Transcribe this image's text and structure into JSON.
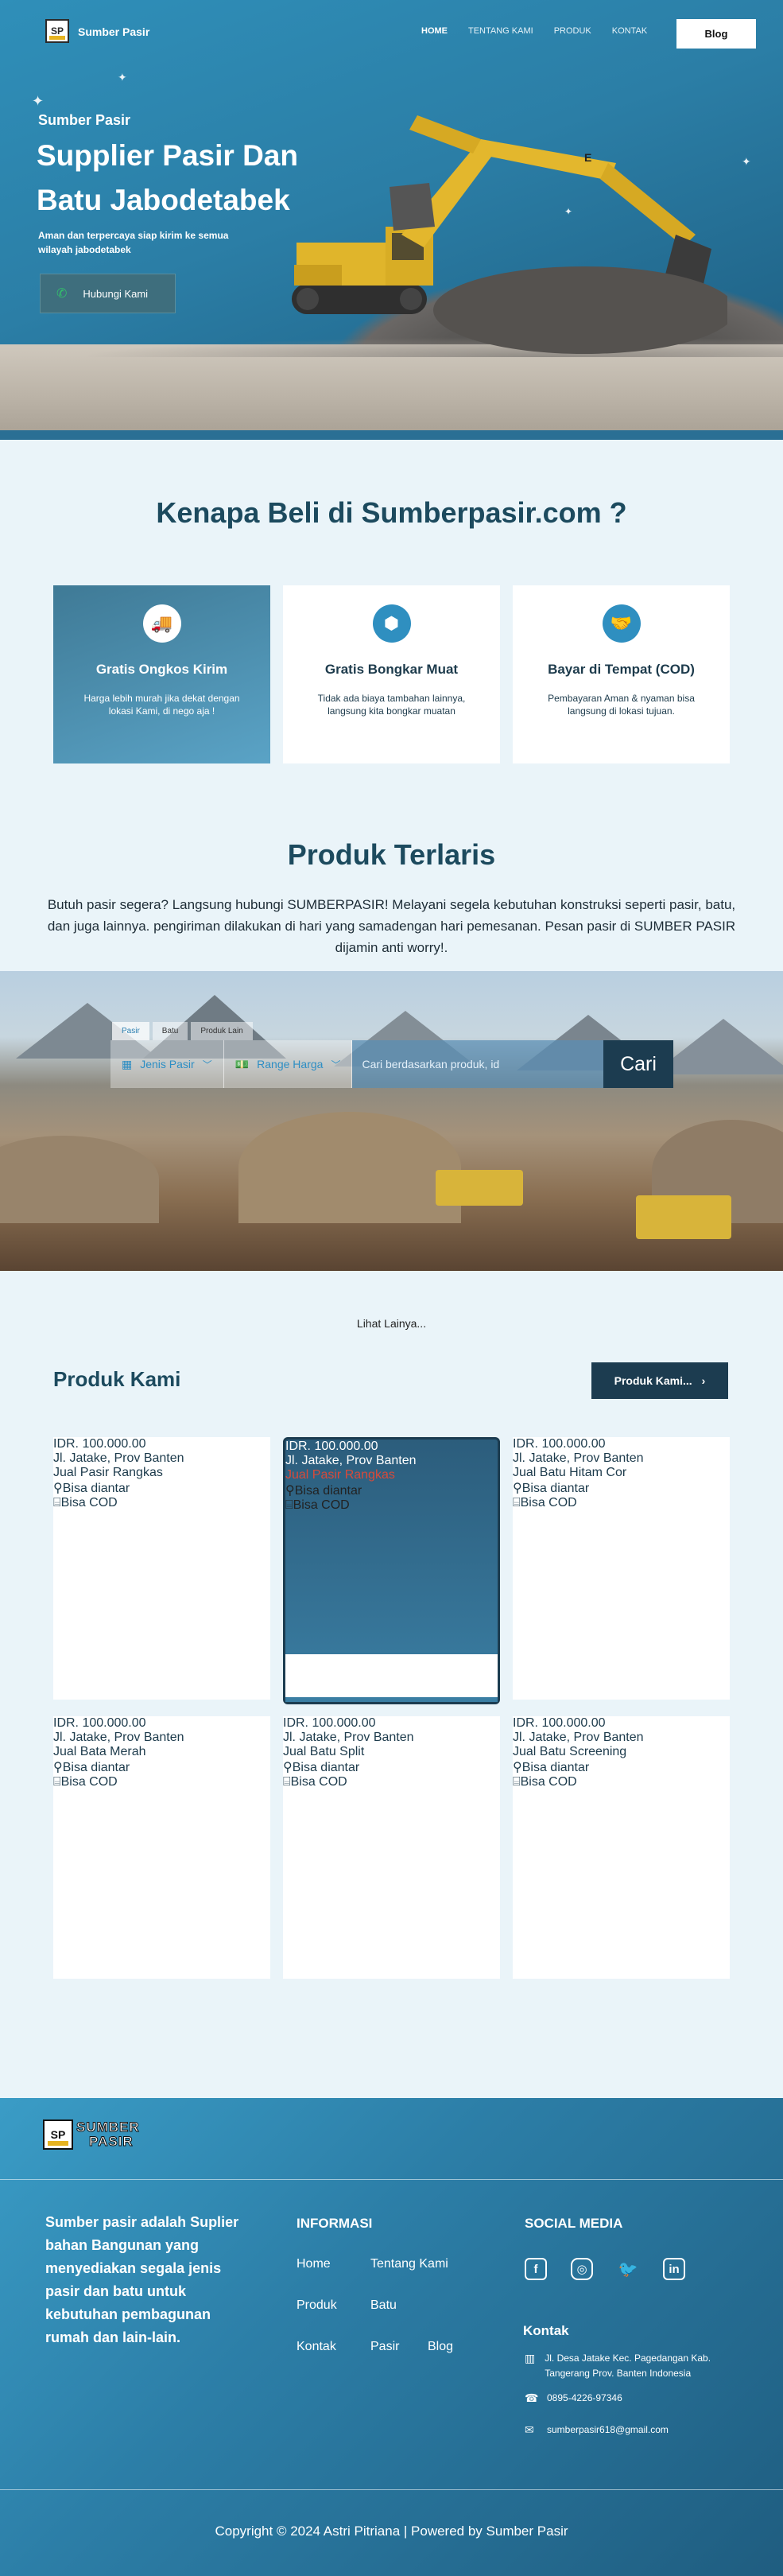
{
  "nav": {
    "logo_text": "SP",
    "brand": "Sumber Pasir",
    "links": [
      "HOME",
      "TENTANG KAMI",
      "PRODUK",
      "KONTAK"
    ],
    "blog_label": "Blog"
  },
  "hero": {
    "eyebrow": "Sumber Pasir",
    "title": "Supplier Pasir Dan Batu Jabodetabek",
    "subtitle": "Aman dan terpercaya siap kirim ke semua wilayah jabodetabek",
    "cta_label": "Hubungi Kami",
    "machine_badge": "E"
  },
  "why": {
    "title": "Kenapa Beli di Sumberpasir.com ?",
    "cards": [
      {
        "title": "Gratis Ongkos Kirim",
        "text": "Harga lebih murah jika dekat dengan lokasi Kami, di nego aja !",
        "icon": "truck-icon"
      },
      {
        "title": "Gratis Bongkar Muat",
        "text": "Tidak ada biaya tambahan lainnya, langsung kita bongkar muatan",
        "icon": "box-icon"
      },
      {
        "title": "Bayar di Tempat (COD)",
        "text": "Pembayaran Aman & nyaman bisa langsung di lokasi tujuan.",
        "icon": "handshake-icon"
      }
    ]
  },
  "terlaris": {
    "title": "Produk Terlaris",
    "text": "Butuh pasir segera? Langsung hubungi SUMBERPASIR! Melayani segela kebutuhan konstruksi seperti pasir, batu, dan juga lainnya. pengiriman dilakukan di hari yang samadengan hari pemesanan. Pesan pasir di SUMBER PASIR dijamin anti worry!."
  },
  "search": {
    "tabs": [
      "Pasir",
      "Batu",
      "Produk Lain"
    ],
    "jenis_label": "Jenis Pasir",
    "range_label": "Range Harga",
    "placeholder": "Cari berdasarkan produk, id",
    "button": "Cari"
  },
  "produk": {
    "lihat": "Lihat Lainya...",
    "title": "Produk  Kami",
    "button": "Produk  Kami...",
    "feature_diantar": "Bisa diantar",
    "feature_cod": "Bisa COD",
    "items": [
      {
        "price": "IDR. 100.000.00",
        "location": "Jl. Jatake, Prov Banten",
        "category": "Jual Pasir Rangkas"
      },
      {
        "price": "IDR. 100.000.00",
        "location": "Jl. Jatake, Prov Banten",
        "category": "Jual Pasir Rangkas"
      },
      {
        "price": "IDR. 100.000.00",
        "location": "Jl. Jatake, Prov Banten",
        "category": "Jual Batu Hitam Cor"
      },
      {
        "price": "IDR. 100.000.00",
        "location": "Jl. Jatake, Prov Banten",
        "category": "Jual Bata Merah"
      },
      {
        "price": "IDR. 100.000.00",
        "location": "Jl. Jatake, Prov Banten",
        "category": "Jual Batu Split"
      },
      {
        "price": "IDR. 100.000.00",
        "location": "Jl. Jatake, Prov Banten",
        "category": "Jual Batu Screening"
      }
    ]
  },
  "footer": {
    "logo_line1": "SUMBER",
    "logo_line2": "PASIR",
    "about": "Sumber pasir adalah Suplier bahan Bangunan yang menyediakan segala jenis pasir dan batu untuk kebutuhan pembagunan rumah dan lain-lain.",
    "informasi_title": "INFORMASI",
    "links": [
      "Home",
      "Tentang Kami",
      "Produk",
      "Batu",
      "Kontak",
      "Pasir",
      "Blog"
    ],
    "social_title": "SOCIAL MEDIA",
    "kontak_title": "Kontak",
    "address": "Jl. Desa Jatake Kec. Pagedangan Kab. Tangerang Prov. Banten Indonesia",
    "phone": "0895-4226-97346",
    "email": "sumberpasir618@gmail.com",
    "copyright": "Copyright © 2024 Astri Pitriana | Powered by Sumber Pasir"
  },
  "colors": {
    "primary_dark": "#1c3c50",
    "primary": "#2b7ea6",
    "accent_red": "#d0241f",
    "background": "#eaf4f9"
  }
}
